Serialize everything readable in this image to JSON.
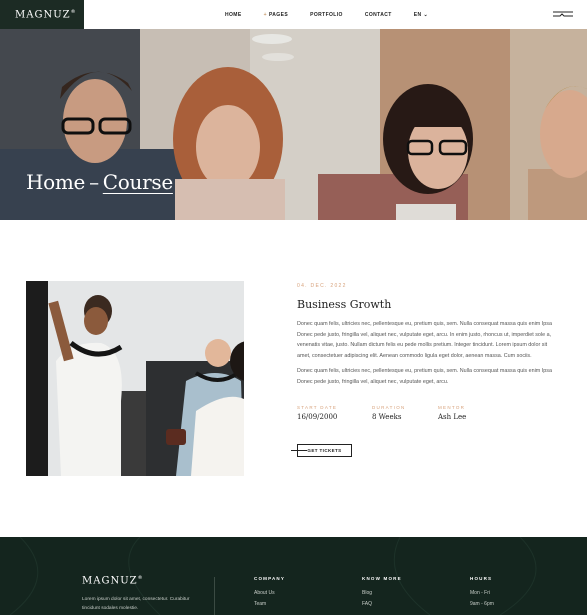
{
  "header": {
    "logo": "MAGNUZ",
    "logo_mark": "®",
    "nav": [
      {
        "label": "HOME",
        "prefix": "",
        "suffix": ""
      },
      {
        "label": "PAGES",
        "prefix": "+",
        "suffix": ""
      },
      {
        "label": "PORTFOLIO",
        "prefix": "",
        "suffix": ""
      },
      {
        "label": "CONTACT",
        "prefix": "",
        "suffix": ""
      },
      {
        "label": "EN",
        "prefix": "",
        "suffix": "⌄"
      }
    ],
    "menu_icon": "hamburger-icon"
  },
  "hero": {
    "crumb_home": "Home",
    "separator": "–",
    "crumb_current": "Course"
  },
  "course": {
    "date": "04. DEC. 2022",
    "title": "Business Growth",
    "paragraph1": "Donec quam felis, ultricies nec, pellentesque eu, pretium quis, sem. Nulla consequat massa quis enim Ipsa Donec pede justo, fringilla vel, aliquet nec, vulputate eget, arcu. In enim justo, rhoncus ut, imperdiet sole a, venenatis vitae, justo. Nullam dictum felis eu pede mollis pretium. Integer tincidunt. Lorem ipsum dolor sit amet, consectetuer adipiscing elit. Aenean commodo ligula eget dolor, aenean massa. Cum sociis.",
    "paragraph2": "Donec quam felis, ultricies nec, pellentesque eu, pretium quis, sem. Nulla consequat massa quis enim Ipsa Donec pede justo, fringilla vel, aliquet nec, vulputate eget, arcu.",
    "meta": [
      {
        "label": "START DATE",
        "value": "16/09/2000"
      },
      {
        "label": "DURATION",
        "value": "8 Weeks"
      },
      {
        "label": "MENTOR",
        "value": "Ash Lee"
      }
    ],
    "button": "GET TICKETS"
  },
  "footer": {
    "logo": "MAGNUZ",
    "logo_mark": "®",
    "text": "Lorem ipsum dolor sit amet, consectetur. Curabitur tincidunt sodales molestie.",
    "columns": [
      {
        "title": "COMPANY",
        "items": [
          "About Us",
          "Team"
        ]
      },
      {
        "title": "KNOW MORE",
        "items": [
          "Blog",
          "FAQ"
        ]
      },
      {
        "title": "HOURS",
        "items": [
          "Mon - Fri",
          "9am - 6pm"
        ]
      }
    ]
  },
  "colors": {
    "accent": "#d7a27c",
    "dark": "#1c2b24",
    "footer_bg": "#14251e"
  }
}
